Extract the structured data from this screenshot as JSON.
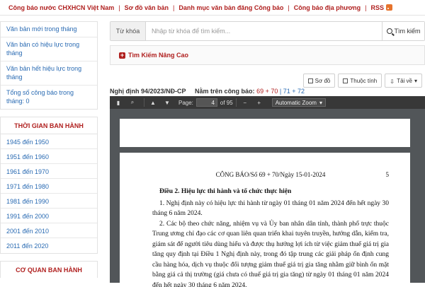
{
  "topnav": {
    "items": [
      "Công báo nước CHXHCN Việt Nam",
      "Sơ đồ văn bản",
      "Danh mục văn bản đăng Công báo",
      "Công báo địa phương",
      "RSS"
    ]
  },
  "sidebar": {
    "links": [
      "Văn bản mới trong tháng",
      "Văn bản có hiệu lực trong tháng",
      "Văn bản hết hiệu lực trong tháng",
      "Tổng số công báo trong tháng: 0"
    ],
    "time_heading": "THỜI GIAN BAN HÀNH",
    "time_ranges": [
      "1945 đến 1950",
      "1951 đến 1960",
      "1961 đến 1970",
      "1971 đến 1980",
      "1981 đến 1990",
      "1991 đến 2000",
      "2001 đến 2010",
      "2011 đến 2020"
    ],
    "agency_heading": "CƠ QUAN BAN HÀNH"
  },
  "search": {
    "label": "Từ khóa",
    "placeholder": "Nhập từ khóa để tìm kiếm...",
    "button": "Tìm kiếm"
  },
  "advanced_search": "Tìm Kiếm Nâng Cao",
  "actions": {
    "diagram": "Sơ đồ",
    "attributes": "Thuộc tính",
    "download": "Tải về"
  },
  "document": {
    "title": "Nghị định 94/2023/NĐ-CP",
    "gazette_label": "Nằm trên công báo:",
    "pages_main": "69 + 70",
    "pages_extra": "| 71 + 72"
  },
  "viewer": {
    "page_label": "Page:",
    "page_value": "4",
    "page_total": "of 95",
    "zoom": "Automatic Zoom"
  },
  "page": {
    "header": "CÔNG BÁO/Số 69 + 70/Ngày 15-01-2024",
    "page_number": "5",
    "article_title": "Điều 2. Hiệu lực thi hành và tổ chức thực hiện",
    "para1": "1. Nghị định này có hiệu lực thi hành từ ngày 01 tháng 01 năm 2024 đến hết ngày 30 tháng 6 năm 2024.",
    "para2": "2. Các bộ theo chức năng, nhiệm vụ và Ủy ban nhân dân tỉnh, thành phố trực thuộc Trung ương chỉ đạo các cơ quan liên quan triển khai tuyên truyền, hướng dẫn, kiểm tra, giám sát để người tiêu dùng hiểu và được thụ hưởng lợi ích từ việc giảm thuế giá trị gia tăng quy định tại Điều 1 Nghị định này, trong đó tập trung các giải pháp ổn định cung cầu hàng hóa, dịch vụ thuộc đối tượng giảm thuế giá trị gia tăng nhằm giữ bình ổn mặt bằng giá cả thị trường (giá chưa có thuế giá trị gia tăng) từ ngày 01 tháng 01 năm 2024 đến hết ngày 30 tháng 6 năm 2024."
  },
  "colors": {
    "accent_red": "#b0201f",
    "link_blue": "#2a6bb3",
    "viewer_bg": "#525659",
    "toolbar_bg": "#383838"
  }
}
